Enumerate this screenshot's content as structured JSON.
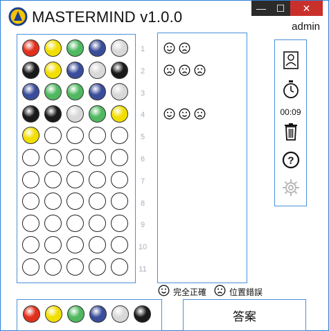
{
  "window": {
    "title": "MASTERMIND v1.0.0",
    "user": "admin",
    "controls": {
      "minimize": "—",
      "maximize": "☐",
      "close": "✕"
    }
  },
  "colors": {
    "red": "#e0301c",
    "yellow": "#f2de00",
    "green": "#4fb860",
    "blue": "#3a4d9a",
    "white": "#d8d8d8",
    "black": "#1a1a1a",
    "accent": "#4a90d9"
  },
  "board": {
    "rows": [
      {
        "number": "1",
        "pegs": [
          "red",
          "yellow",
          "green",
          "blue",
          "white"
        ]
      },
      {
        "number": "2",
        "pegs": [
          "black",
          "yellow",
          "blue",
          "white",
          "black"
        ]
      },
      {
        "number": "3",
        "pegs": [
          "blue",
          "green",
          "green",
          "blue",
          "white"
        ]
      },
      {
        "number": "4",
        "pegs": [
          "black",
          "black",
          "white",
          "green",
          "yellow"
        ]
      },
      {
        "number": "5",
        "pegs": [
          "yellow",
          "empty",
          "empty",
          "empty",
          "empty"
        ]
      },
      {
        "number": "6",
        "pegs": [
          "empty",
          "empty",
          "empty",
          "empty",
          "empty"
        ]
      },
      {
        "number": "7",
        "pegs": [
          "empty",
          "empty",
          "empty",
          "empty",
          "empty"
        ]
      },
      {
        "number": "8",
        "pegs": [
          "empty",
          "empty",
          "empty",
          "empty",
          "empty"
        ]
      },
      {
        "number": "9",
        "pegs": [
          "empty",
          "empty",
          "empty",
          "empty",
          "empty"
        ]
      },
      {
        "number": "10",
        "pegs": [
          "empty",
          "empty",
          "empty",
          "empty",
          "empty"
        ]
      },
      {
        "number": "11",
        "pegs": [
          "empty",
          "empty",
          "empty",
          "empty",
          "empty"
        ]
      }
    ]
  },
  "feedback": {
    "rows": [
      [
        "happy",
        "sad"
      ],
      [
        "sad",
        "sad",
        "sad"
      ],
      [],
      [
        "happy",
        "happy",
        "sad"
      ]
    ]
  },
  "legend": {
    "correct_label": "完全正確",
    "position_label": "位置錯誤"
  },
  "toolbar": {
    "timer": "00:09",
    "icons": [
      "profile-icon",
      "stopwatch-icon",
      "trash-icon",
      "help-icon",
      "settings-icon"
    ]
  },
  "palette": {
    "colors": [
      "red",
      "yellow",
      "green",
      "blue",
      "white",
      "black"
    ]
  },
  "answer_label": "答案"
}
